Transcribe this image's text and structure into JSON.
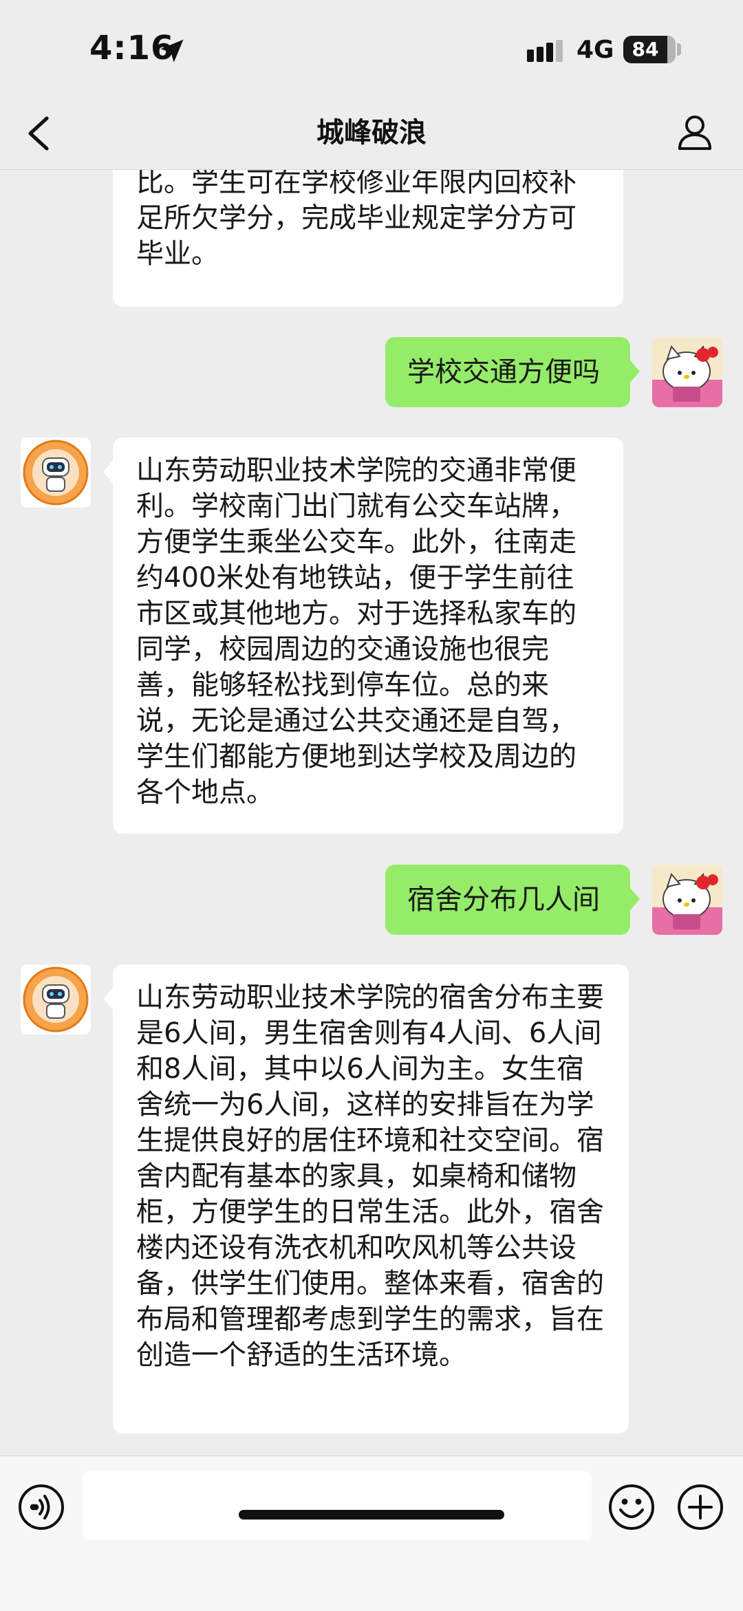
{
  "status_bar": {
    "time": "4:16",
    "network": "4G",
    "battery_level": "84",
    "location_icon": "location-arrow-icon",
    "signal_icon": "cellular-signal-icon"
  },
  "nav": {
    "back_icon": "chevron-left-icon",
    "title": "城峰破浪",
    "profile_icon": "person-icon"
  },
  "messages": [
    {
      "side": "received",
      "text": "挨着，于期末是你含不得参加先优评比。学生可在学校修业年限内回校补足所欠学分，完成毕业规定学分方可毕业。"
    },
    {
      "side": "sent",
      "text": "学校交通方便吗"
    },
    {
      "side": "received",
      "text": "山东劳动职业技术学院的交通非常便利。学校南门出门就有公交车站牌，方便学生乘坐公交车。此外，往南走约400米处有地铁站，便于学生前往市区或其他地方。对于选择私家车的同学，校园周边的交通设施也很完善，能够轻松找到停车位。总的来说，无论是通过公共交通还是自驾，学生们都能方便地到达学校及周边的各个地点。"
    },
    {
      "side": "sent",
      "text": "宿舍分布几人间"
    },
    {
      "side": "received",
      "text": "山东劳动职业技术学院的宿舍分布主要是6人间，男生宿舍则有4人间、6人间和8人间，其中以6人间为主。女生宿舍统一为6人间，这样的安排旨在为学生提供良好的居住环境和社交空间。宿舍内配有基本的家具，如桌椅和储物柜，方便学生的日常生活。此外，宿舍楼内还设有洗衣机和吹风机等公共设备，供学生们使用。整体来看，宿舍的布局和管理都考虑到学生的需求，旨在创造一个舒适的生活环境。"
    }
  ],
  "avatars": {
    "bot_icon": "robot-avatar-icon",
    "user_icon": "hello-kitty-avatar-icon"
  },
  "input_bar": {
    "voice_icon": "voice-input-icon",
    "placeholder": "",
    "emoji_icon": "emoji-icon",
    "plus_icon": "plus-circle-icon"
  },
  "colors": {
    "background": "#ededed",
    "sent_bubble": "#95ec69",
    "received_bubble": "#ffffff"
  }
}
